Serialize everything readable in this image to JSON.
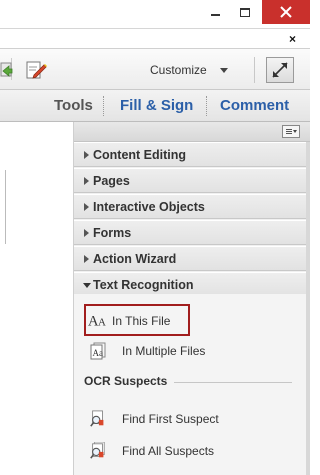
{
  "window": {
    "minimize_icon": "minimize-icon",
    "maximize_icon": "maximize-icon",
    "close_icon": "close-icon",
    "close_color": "#c9302c"
  },
  "toolbar": {
    "close_x": "×",
    "customize_label": "Customize",
    "expand_icon": "expand-icon"
  },
  "tabs": {
    "tools": "Tools",
    "fill_sign": "Fill & Sign",
    "comment": "Comment",
    "accent": "#2b5fa8"
  },
  "pane": {
    "panels": [
      {
        "label": "Content Editing",
        "expanded": false
      },
      {
        "label": "Pages",
        "expanded": false
      },
      {
        "label": "Interactive Objects",
        "expanded": false
      },
      {
        "label": "Forms",
        "expanded": false
      },
      {
        "label": "Action Wizard",
        "expanded": false
      },
      {
        "label": "Text Recognition",
        "expanded": true
      }
    ],
    "text_recognition": {
      "items": [
        {
          "label": "In This File",
          "icon": "text-aa-icon",
          "selected": true
        },
        {
          "label": "In Multiple Files",
          "icon": "multiple-files-icon",
          "selected": false
        }
      ],
      "ocr_title": "OCR Suspects",
      "ocr_items": [
        {
          "label": "Find First Suspect",
          "icon": "find-suspect-icon"
        },
        {
          "label": "Find All Suspects",
          "icon": "find-all-suspects-icon"
        }
      ]
    },
    "highlight_color": "#a11d1d"
  }
}
